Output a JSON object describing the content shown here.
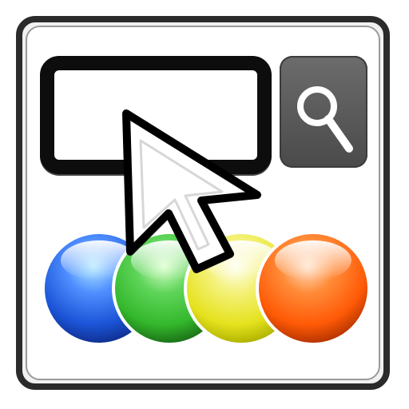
{
  "app": {
    "icon": "search-cursor-app-icon"
  },
  "search": {
    "input_value": "",
    "button_icon": "search-icon"
  },
  "cursor": {
    "icon": "pointer-cursor-icon"
  },
  "color_balls": [
    {
      "name": "blue",
      "color": "#1b54d6"
    },
    {
      "name": "green",
      "color": "#34b82c"
    },
    {
      "name": "yellow",
      "color": "#e5e21d"
    },
    {
      "name": "orange",
      "color": "#ff5a06"
    }
  ]
}
